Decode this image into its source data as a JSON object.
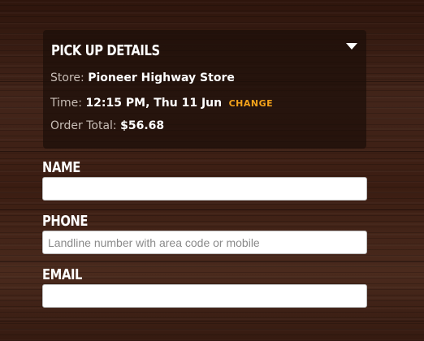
{
  "pickup": {
    "title": "PICK UP DETAILS",
    "store_label": "Store:",
    "store_value": "Pioneer Highway Store",
    "time_label": "Time:",
    "time_value": "12:15 PM, Thu 11 Jun",
    "change_label": "CHANGE",
    "total_label": "Order Total:",
    "total_value": "$56.68",
    "toggle_icon": "caret-down-icon"
  },
  "form": {
    "name_label": "NAME",
    "name_value": "",
    "name_placeholder": "",
    "phone_label": "PHONE",
    "phone_value": "",
    "phone_placeholder": "Landline number with area code or mobile",
    "email_label": "EMAIL",
    "email_value": "",
    "email_placeholder": ""
  },
  "colors": {
    "accent": "#f3a21a",
    "panel_background": "rgba(28,14,9,0.72)",
    "wood_background": "#3a1e12"
  }
}
